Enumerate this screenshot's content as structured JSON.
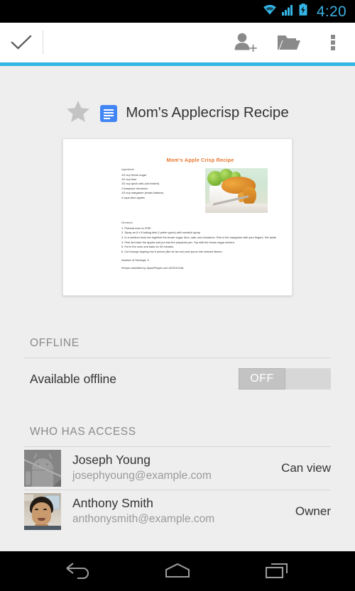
{
  "status_bar": {
    "time": "4:20",
    "icons": [
      "wifi-icon",
      "signal-icon",
      "battery-charging-icon"
    ],
    "accent_color": "#33b5e5",
    "background": "#000000"
  },
  "action_bar": {
    "done_label": "done-check",
    "buttons": [
      {
        "name": "add-person-button",
        "label": "Add people"
      },
      {
        "name": "move-folder-button",
        "label": "Move to folder"
      },
      {
        "name": "overflow-menu-button",
        "label": "More options"
      }
    ],
    "accent_color": "#33b5e5"
  },
  "document": {
    "starred": false,
    "star_label": "Star",
    "type_icon": "google-docs-icon",
    "title": "Mom's Applecrisp Recipe",
    "preview": {
      "heading": "Mom's Apple Crisp Recipe",
      "ingredients_label": "Ingredients",
      "ingredients": [
        "1/2 cup brown sugar",
        "1/2 cup flour",
        "1/2 cup quick oats (not instant)",
        "1 teaspoon cinnamon",
        "1/3 cup margarine (smart balance)",
        "4 cups slice apples"
      ],
      "directions_label": "Directions",
      "directions": [
        "1. Preheat oven to 375F.",
        "2. Spray an 8 x 8 baking dish (I prefer pyrex) with nonstick spray.",
        "3. In a medium bowl mix together the brown sugar, flour, oats, and cinnamon. Rub in the margarine with your fingers. Set aside",
        "4. Peel and slice the apples and put into the prepared pan. Top with the brown sugar mixture.",
        "5. Put in the oven and bake for 30 minutes.",
        "6. Cut through topping into 9 pieces (like tic tac toe) and spoon into dessert dishes."
      ],
      "directions_link_text": "medium bowl",
      "servings": "Number of Servings: 9",
      "credit": "Recipe submitted by SparkPeople user ANTIOCHIA.",
      "photo_alt": "apple-crisp-photo"
    }
  },
  "offline_section": {
    "header": "OFFLINE",
    "row_label": "Available offline",
    "toggle_state": "OFF"
  },
  "access_section": {
    "header": "WHO HAS ACCESS",
    "people": [
      {
        "name": "Joseph Young",
        "email": "josephyoung@example.com",
        "role": "Can view",
        "avatar": "android-default-avatar"
      },
      {
        "name": "Anthony Smith",
        "email": "anthonysmith@example.com",
        "role": "Owner",
        "avatar": "photo-avatar"
      }
    ]
  },
  "nav_bar": {
    "buttons": [
      {
        "name": "back-button",
        "label": "Back"
      },
      {
        "name": "home-button",
        "label": "Home"
      },
      {
        "name": "recents-button",
        "label": "Recent apps"
      }
    ]
  }
}
